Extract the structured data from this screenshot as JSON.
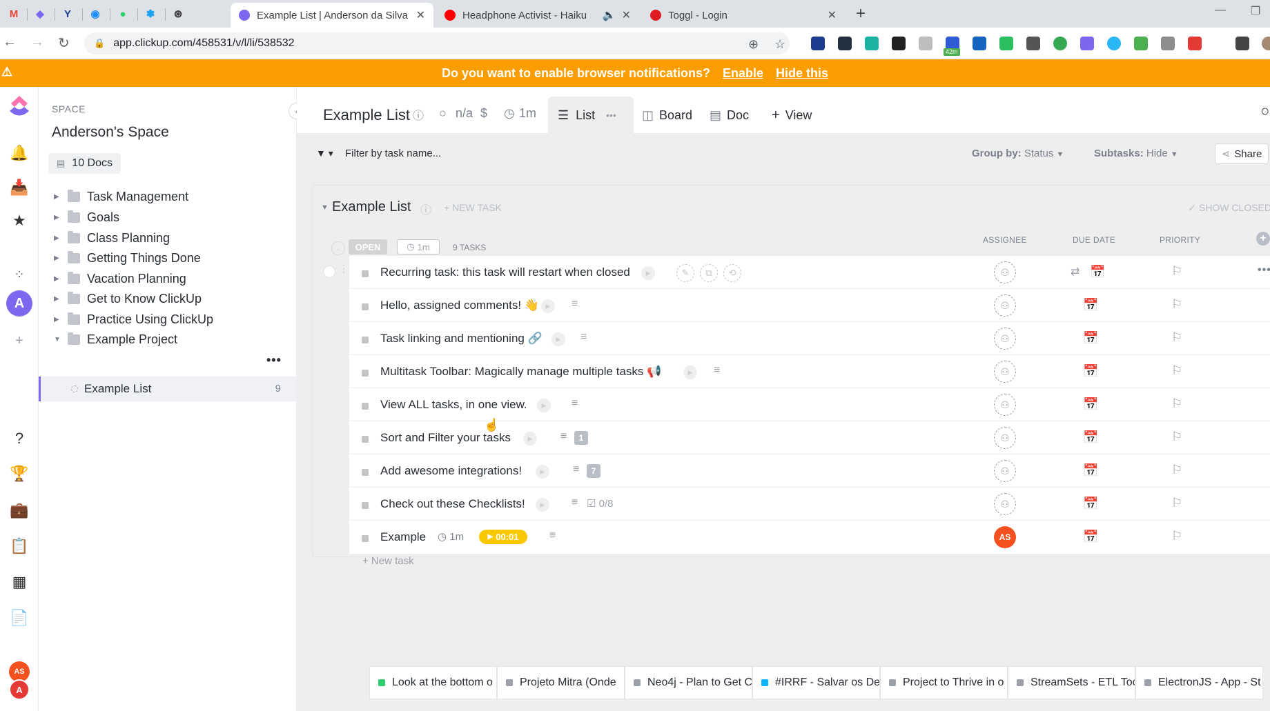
{
  "browser": {
    "tabs": [
      {
        "title": "Example List | Anderson da Silva",
        "color": "#7b68ee",
        "active": true
      },
      {
        "title": "Headphone Activist - Haiku",
        "color": "#ff0000",
        "active": false
      },
      {
        "title": "Toggl - Login",
        "color": "#e01b22",
        "active": false
      }
    ],
    "url": "app.clickup.com/458531/v/l/li/538532",
    "ext_badge": "42m"
  },
  "banner": {
    "text": "Do you want to enable browser notifications?",
    "enable_label": "Enable",
    "hide_label": "Hide this"
  },
  "sidebar": {
    "space_label": "SPACE",
    "space_name": "Anderson's Space",
    "docs_label": "10 Docs",
    "folders": [
      "Task Management",
      "Goals",
      "Class Planning",
      "Getting Things Done",
      "Vacation Planning",
      "Get to Know ClickUp",
      "Practice Using ClickUp",
      "Example Project"
    ],
    "active_list": {
      "name": "Example List",
      "count": "9"
    },
    "folder_menu": "•••",
    "avatar_initial": "A",
    "avatar_user": "AS"
  },
  "header": {
    "list_title": "Example List",
    "status": "n/a",
    "time_estimate": "1m",
    "views": {
      "list": "List",
      "board": "Board",
      "doc": "Doc",
      "add_view": "View"
    },
    "list_menu": "•••"
  },
  "filterbar": {
    "filter_placeholder": "Filter by task name...",
    "group_by_label": "Group by:",
    "group_by_value": "Status",
    "subtasks_label": "Subtasks:",
    "subtasks_value": "Hide",
    "share_label": "Share"
  },
  "group": {
    "title": "Example List",
    "new_task_label": "+ NEW TASK",
    "show_closed": "SHOW CLOSED",
    "status_label": "OPEN",
    "time_label": "1m",
    "task_count": "9 TASKS",
    "columns": {
      "assignee": "ASSIGNEE",
      "due": "DUE DATE",
      "priority": "PRIORITY"
    }
  },
  "tasks": [
    {
      "name": "Recurring task: this task will restart when closed",
      "emoji": ""
    },
    {
      "name": "Hello, assigned comments!",
      "emoji": "👋"
    },
    {
      "name": "Task linking and mentioning",
      "emoji": "🔗"
    },
    {
      "name": "Multitask Toolbar: Magically manage multiple tasks",
      "emoji": "📢"
    },
    {
      "name": "View ALL tasks, in one view.",
      "emoji": ""
    },
    {
      "name": "Sort and Filter your tasks",
      "emoji": "",
      "badge": "1"
    },
    {
      "name": "Add awesome integrations!",
      "emoji": "",
      "badge": "7"
    },
    {
      "name": "Check out these Checklists!",
      "emoji": "",
      "checklist": "0/8"
    },
    {
      "name": "Example",
      "emoji": "",
      "time": "1m",
      "timer": "00:01",
      "assignee": "AS"
    }
  ],
  "new_task_bottom": "+ New task",
  "tray": [
    {
      "label": "Look at the bottom o",
      "color": "#2ecd6f"
    },
    {
      "label": "Projeto Mitra (Onde",
      "color": "#9ca0a8"
    },
    {
      "label": "Neo4j - Plan to Get C",
      "color": "#9ca0a8"
    },
    {
      "label": "#IRRF - Salvar os Der",
      "color": "#0ab4ff"
    },
    {
      "label": "Project to Thrive in o",
      "color": "#9ca0a8"
    },
    {
      "label": "StreamSets - ETL Too",
      "color": "#9ca0a8"
    },
    {
      "label": "ElectronJS - App - St",
      "color": "#9ca0a8"
    }
  ],
  "colors": {
    "accent": "#7b68ee",
    "banner": "#fa9d00",
    "timer": "#fac800",
    "avatar": "#f4511e"
  }
}
